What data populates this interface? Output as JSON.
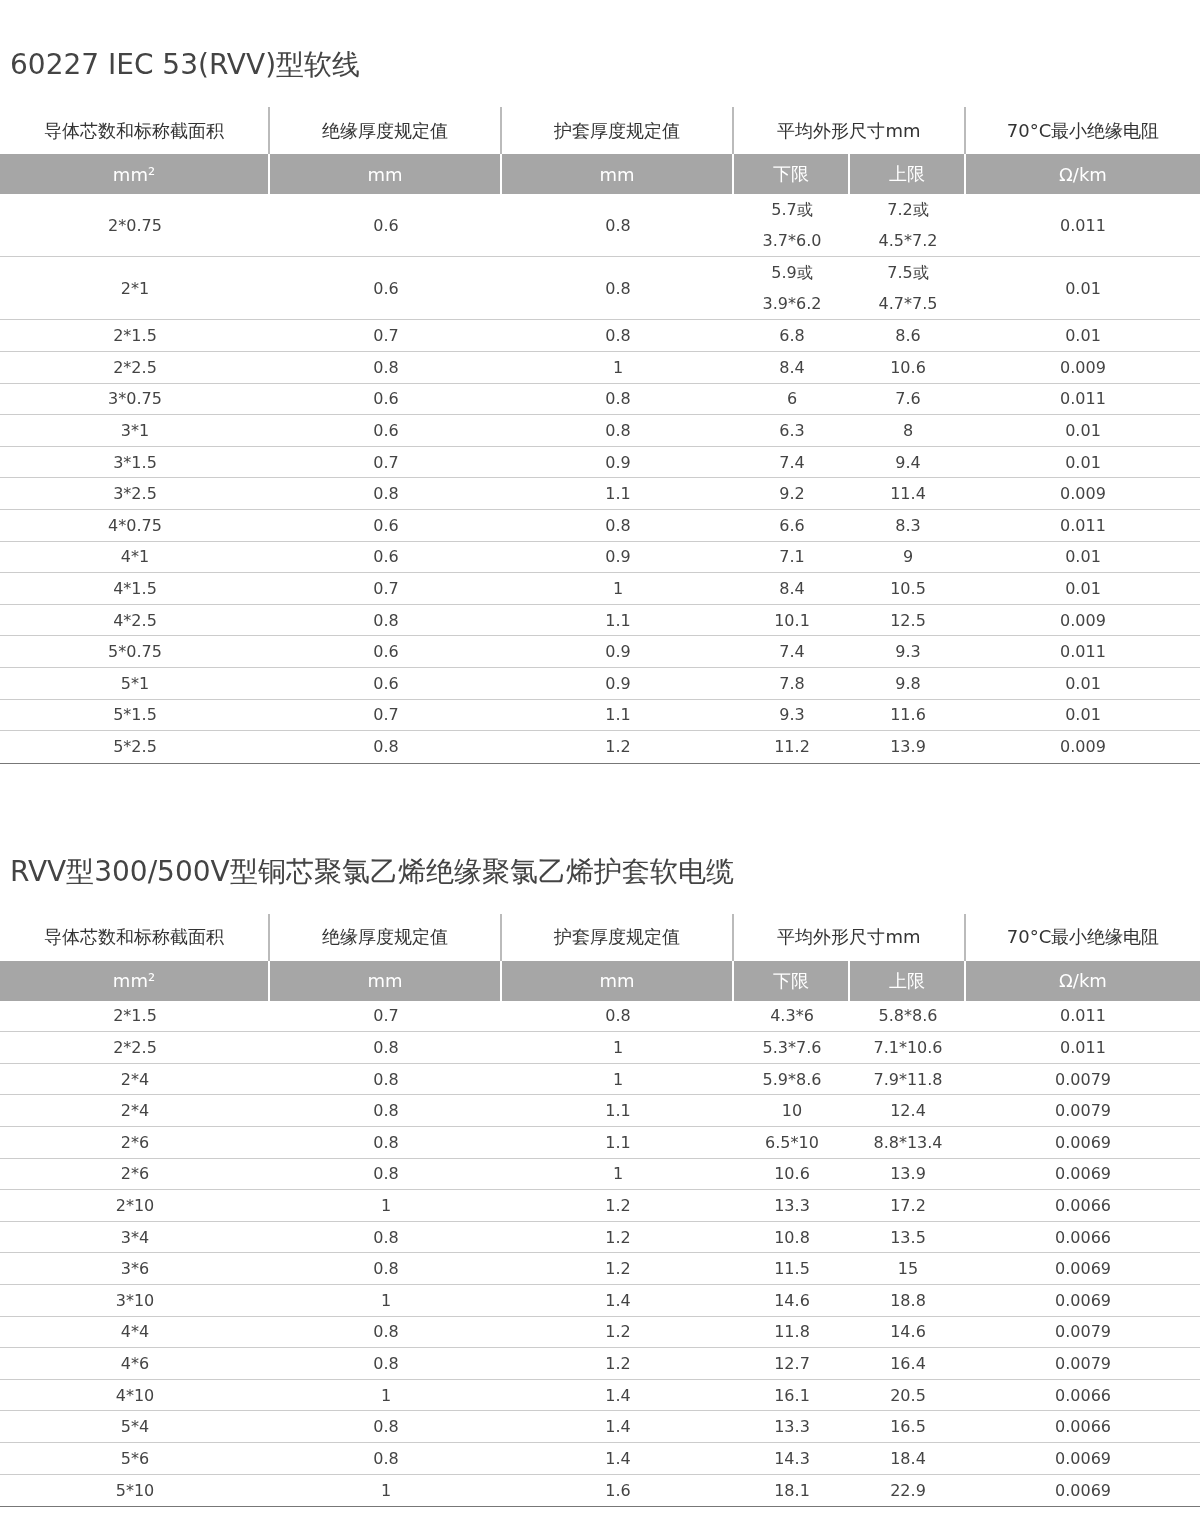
{
  "tables": [
    {
      "title": "60227 IEC 53(RVV)型软线",
      "headers": [
        "导体芯数和标称截面积",
        "绝缘厚度规定值",
        "护套厚度规定值",
        "平均外形尺寸mm",
        "70°C最小绝缘电阻"
      ],
      "units": [
        "mm²",
        "mm",
        "mm",
        "下限",
        "上限",
        "Ω/km"
      ],
      "rows": [
        [
          "2*0.75",
          "0.6",
          "0.8",
          "5.7或\n3.7*6.0",
          "7.2或\n4.5*7.2",
          "0.011"
        ],
        [
          "2*1",
          "0.6",
          "0.8",
          "5.9或\n3.9*6.2",
          "7.5或\n4.7*7.5",
          "0.01"
        ],
        [
          "2*1.5",
          "0.7",
          "0.8",
          "6.8",
          "8.6",
          "0.01"
        ],
        [
          "2*2.5",
          "0.8",
          "1",
          "8.4",
          "10.6",
          "0.009"
        ],
        [
          "3*0.75",
          "0.6",
          "0.8",
          "6",
          "7.6",
          "0.011"
        ],
        [
          "3*1",
          "0.6",
          "0.8",
          "6.3",
          "8",
          "0.01"
        ],
        [
          "3*1.5",
          "0.7",
          "0.9",
          "7.4",
          "9.4",
          "0.01"
        ],
        [
          "3*2.5",
          "0.8",
          "1.1",
          "9.2",
          "11.4",
          "0.009"
        ],
        [
          "4*0.75",
          "0.6",
          "0.8",
          "6.6",
          "8.3",
          "0.011"
        ],
        [
          "4*1",
          "0.6",
          "0.9",
          "7.1",
          "9",
          "0.01"
        ],
        [
          "4*1.5",
          "0.7",
          "1",
          "8.4",
          "10.5",
          "0.01"
        ],
        [
          "4*2.5",
          "0.8",
          "1.1",
          "10.1",
          "12.5",
          "0.009"
        ],
        [
          "5*0.75",
          "0.6",
          "0.9",
          "7.4",
          "9.3",
          "0.011"
        ],
        [
          "5*1",
          "0.6",
          "0.9",
          "7.8",
          "9.8",
          "0.01"
        ],
        [
          "5*1.5",
          "0.7",
          "1.1",
          "9.3",
          "11.6",
          "0.01"
        ],
        [
          "5*2.5",
          "0.8",
          "1.2",
          "11.2",
          "13.9",
          "0.009"
        ]
      ]
    },
    {
      "title": "RVV型300/500V型铜芯聚氯乙烯绝缘聚氯乙烯护套软电缆",
      "headers": [
        "导体芯数和标称截面积",
        "绝缘厚度规定值",
        "护套厚度规定值",
        "平均外形尺寸mm",
        "70°C最小绝缘电阻"
      ],
      "units": [
        "mm²",
        "mm",
        "mm",
        "下限",
        "上限",
        "Ω/km"
      ],
      "rows": [
        [
          "2*1.5",
          "0.7",
          "0.8",
          "4.3*6",
          "5.8*8.6",
          "0.011"
        ],
        [
          "2*2.5",
          "0.8",
          "1",
          "5.3*7.6",
          "7.1*10.6",
          "0.011"
        ],
        [
          "2*4",
          "0.8",
          "1",
          "5.9*8.6",
          "7.9*11.8",
          "0.0079"
        ],
        [
          "2*4",
          "0.8",
          "1.1",
          "10",
          "12.4",
          "0.0079"
        ],
        [
          "2*6",
          "0.8",
          "1.1",
          "6.5*10",
          "8.8*13.4",
          "0.0069"
        ],
        [
          "2*6",
          "0.8",
          "1",
          "10.6",
          "13.9",
          "0.0069"
        ],
        [
          "2*10",
          "1",
          "1.2",
          "13.3",
          "17.2",
          "0.0066"
        ],
        [
          "3*4",
          "0.8",
          "1.2",
          "10.8",
          "13.5",
          "0.0066"
        ],
        [
          "3*6",
          "0.8",
          "1.2",
          "11.5",
          "15",
          "0.0069"
        ],
        [
          "3*10",
          "1",
          "1.4",
          "14.6",
          "18.8",
          "0.0069"
        ],
        [
          "4*4",
          "0.8",
          "1.2",
          "11.8",
          "14.6",
          "0.0079"
        ],
        [
          "4*6",
          "0.8",
          "1.2",
          "12.7",
          "16.4",
          "0.0079"
        ],
        [
          "4*10",
          "1",
          "1.4",
          "16.1",
          "20.5",
          "0.0066"
        ],
        [
          "5*4",
          "0.8",
          "1.4",
          "13.3",
          "16.5",
          "0.0066"
        ],
        [
          "5*6",
          "0.8",
          "1.4",
          "14.3",
          "18.4",
          "0.0069"
        ],
        [
          "5*10",
          "1",
          "1.6",
          "18.1",
          "22.9",
          "0.0069"
        ]
      ]
    }
  ]
}
